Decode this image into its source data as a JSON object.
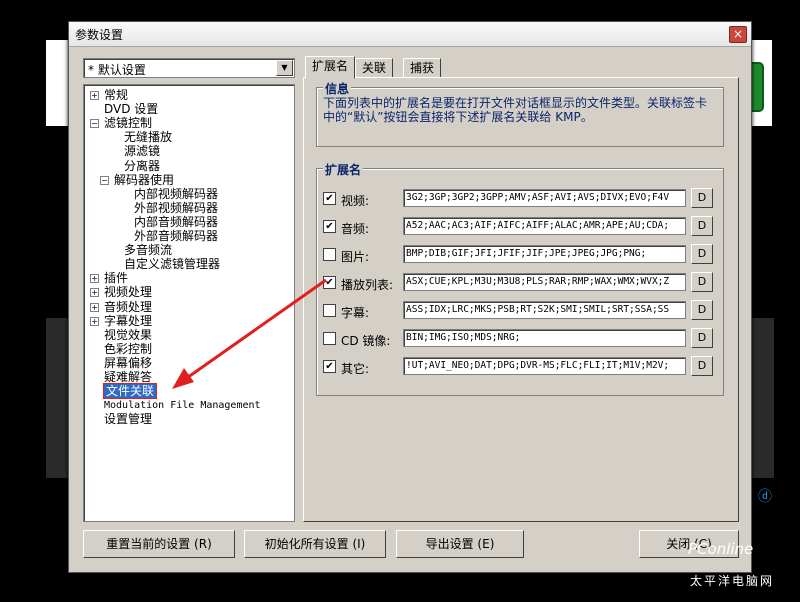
{
  "window": {
    "title": "参数设置",
    "close_glyph": "×"
  },
  "background": {
    "watermark_text": "PConline",
    "watermark_sub": "太平洋电脑网"
  },
  "profile": {
    "value": "* 默认设置",
    "arrow": "▼"
  },
  "tree": {
    "items": [
      {
        "label": "常规",
        "exp": "+"
      },
      {
        "label": "DVD 设置",
        "exp": ""
      },
      {
        "label": "滤镜控制",
        "exp": "−"
      },
      {
        "label": "无缝播放",
        "exp": ""
      },
      {
        "label": "源滤镜",
        "exp": ""
      },
      {
        "label": "分离器",
        "exp": ""
      },
      {
        "label": "解码器使用",
        "exp": "−"
      },
      {
        "label": "内部视频解码器",
        "exp": ""
      },
      {
        "label": "外部视频解码器",
        "exp": ""
      },
      {
        "label": "内部音频解码器",
        "exp": ""
      },
      {
        "label": "外部音频解码器",
        "exp": ""
      },
      {
        "label": "多音频流",
        "exp": ""
      },
      {
        "label": "自定义滤镜管理器",
        "exp": ""
      },
      {
        "label": "插件",
        "exp": "+"
      },
      {
        "label": "视频处理",
        "exp": "+"
      },
      {
        "label": "音频处理",
        "exp": "+"
      },
      {
        "label": "字幕处理",
        "exp": "+"
      },
      {
        "label": "视觉效果",
        "exp": ""
      },
      {
        "label": "色彩控制",
        "exp": ""
      },
      {
        "label": "屏幕偏移",
        "exp": ""
      },
      {
        "label": "疑难解答",
        "exp": ""
      },
      {
        "label": "文件关联",
        "exp": ""
      },
      {
        "label": "Modulation File Management",
        "exp": ""
      },
      {
        "label": "设置管理",
        "exp": ""
      }
    ]
  },
  "tabs": [
    {
      "label": "扩展名"
    },
    {
      "label": "关联"
    },
    {
      "label": "捕获"
    }
  ],
  "info": {
    "title": "信息",
    "text": "下面列表中的扩展名是要在打开文件对话框显示的文件类型。关联标签卡中的“默认”按钮会直接将下述扩展名关联给 KMP。"
  },
  "extensions": {
    "title": "扩展名",
    "d_label": "D",
    "rows": [
      {
        "label": "视频:",
        "checked": true,
        "value": "3G2;3GP;3GP2;3GPP;AMV;ASF;AVI;AVS;DIVX;EVO;F4V"
      },
      {
        "label": "音频:",
        "checked": true,
        "value": "A52;AAC;AC3;AIF;AIFC;AIFF;ALAC;AMR;APE;AU;CDA;"
      },
      {
        "label": "图片:",
        "checked": false,
        "value": "BMP;DIB;GIF;JFI;JFIF;JIF;JPE;JPEG;JPG;PNG;"
      },
      {
        "label": "播放列表:",
        "checked": true,
        "value": "ASX;CUE;KPL;M3U;M3U8;PLS;RAR;RMP;WAX;WMX;WVX;Z"
      },
      {
        "label": "字幕:",
        "checked": false,
        "value": "ASS;IDX;LRC;MKS;PSB;RT;S2K;SMI;SMIL;SRT;SSA;SS"
      },
      {
        "label": "CD 镜像:",
        "checked": false,
        "value": "BIN;IMG;ISO;MDS;NRG;"
      },
      {
        "label": "其它:",
        "checked": true,
        "value": "!UT;AVI_NEO;DAT;DPG;DVR-MS;FLC;FLI;IT;M1V;M2V;"
      }
    ]
  },
  "buttons": {
    "reset_current": "重置当前的设置 (R)",
    "init_all": "初始化所有设置 (I)",
    "export": "导出设置 (E)",
    "close": "关闭 (C)"
  },
  "colors": {
    "selection": "#316ac5",
    "annotation": "#e02020",
    "group_title": "#0a246a"
  }
}
